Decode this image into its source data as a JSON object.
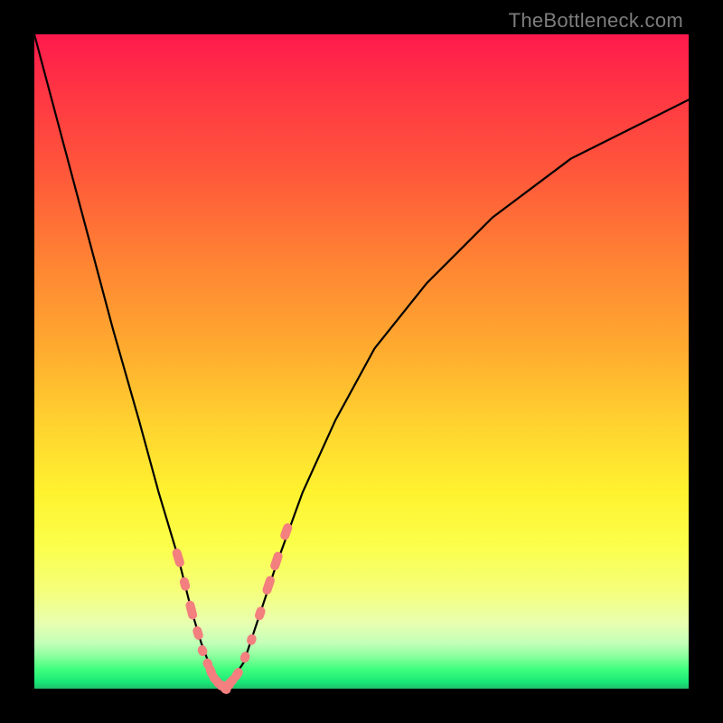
{
  "watermark": "TheBottleneck.com",
  "colors": {
    "frame": "#000000",
    "curve": "#000000",
    "marker": "#f37f7f",
    "gradient_top": "#ff1a4d",
    "gradient_bottom": "#1fbf6a"
  },
  "chart_data": {
    "type": "line",
    "title": "",
    "xlabel": "",
    "ylabel": "",
    "xlim": [
      0,
      100
    ],
    "ylim": [
      0,
      100
    ],
    "grid": false,
    "x": [
      0,
      4,
      8,
      12,
      16,
      19,
      22,
      24,
      25.5,
      27,
      28,
      29,
      30,
      32,
      34,
      37,
      41,
      46,
      52,
      60,
      70,
      82,
      100
    ],
    "values": [
      100,
      85,
      70,
      55,
      41,
      30,
      20,
      12,
      7,
      3,
      1,
      0,
      1,
      4,
      10,
      19,
      30,
      41,
      52,
      62,
      72,
      81,
      90
    ],
    "series": [
      {
        "name": "bottleneck-curve",
        "x": [
          0,
          4,
          8,
          12,
          16,
          19,
          22,
          24,
          25.5,
          27,
          28,
          29,
          30,
          32,
          34,
          37,
          41,
          46,
          52,
          60,
          70,
          82,
          100
        ],
        "y": [
          100,
          85,
          70,
          55,
          41,
          30,
          20,
          12,
          7,
          3,
          1,
          0,
          1,
          4,
          10,
          19,
          30,
          41,
          52,
          62,
          72,
          81,
          90
        ]
      }
    ],
    "markers": {
      "name": "highlighted-points",
      "color": "#f37f7f",
      "x": [
        22,
        23,
        24,
        25,
        25.7,
        26.5,
        27,
        27.5,
        28,
        28.5,
        29,
        29.5,
        30,
        31,
        32.2,
        33.2,
        34.5,
        35.8,
        37,
        38.5
      ],
      "y": [
        20,
        16,
        12,
        8.5,
        5.8,
        3.8,
        2.6,
        1.6,
        1,
        0.5,
        0.2,
        0.3,
        1,
        2.2,
        4.8,
        7.5,
        11.5,
        15.8,
        19.5,
        24
      ],
      "size": [
        20,
        14,
        20,
        14,
        11,
        11,
        14,
        11,
        11,
        11,
        16,
        16,
        16,
        14,
        11,
        11,
        14,
        20,
        20,
        18
      ]
    }
  }
}
